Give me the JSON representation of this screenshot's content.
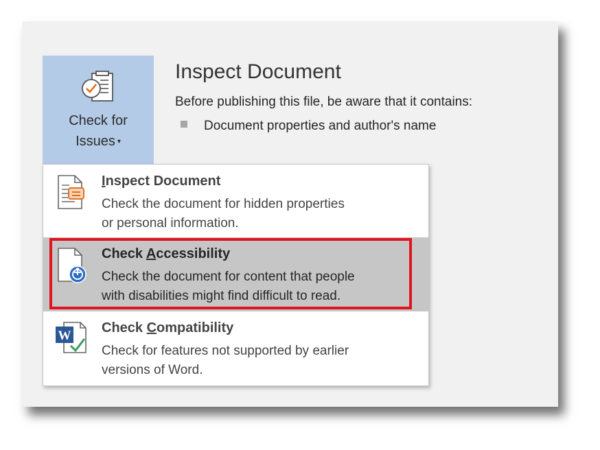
{
  "check_for_issues": {
    "label_line1": "Check for",
    "label_line2": "Issues",
    "caret": "▾",
    "icon": "check-for-issues-icon",
    "bg_color": "#b3cbe6"
  },
  "inspect_section": {
    "title": "Inspect Document",
    "description": "Before publishing this file, be aware that it contains:",
    "bullets": [
      "Document properties and author's name"
    ]
  },
  "menu": {
    "items": [
      {
        "title": "Inspect Document",
        "title_pre": "",
        "title_accel": "I",
        "title_post": "nspect Document",
        "desc_line1": "Check the document for hidden properties",
        "desc_line2": "or personal information.",
        "icon": "inspect-document-icon",
        "highlighted": false
      },
      {
        "title": "Check Accessibility",
        "title_pre": "Check ",
        "title_accel": "A",
        "title_post": "ccessibility",
        "desc_line1": "Check the document for content that people",
        "desc_line2": "with disabilities might find difficult to read.",
        "icon": "check-accessibility-icon",
        "highlighted": true
      },
      {
        "title": "Check Compatibility",
        "title_pre": "Check ",
        "title_accel": "C",
        "title_post": "ompatibility",
        "desc_line1": "Check for features not supported by earlier",
        "desc_line2": "versions of Word.",
        "icon": "check-compatibility-icon",
        "highlighted": false
      }
    ]
  },
  "colors": {
    "highlight_border": "#e0141e",
    "hover_bg": "#c6c6c6",
    "accent_blue": "#2b6cc4",
    "accent_orange": "#e07020"
  }
}
